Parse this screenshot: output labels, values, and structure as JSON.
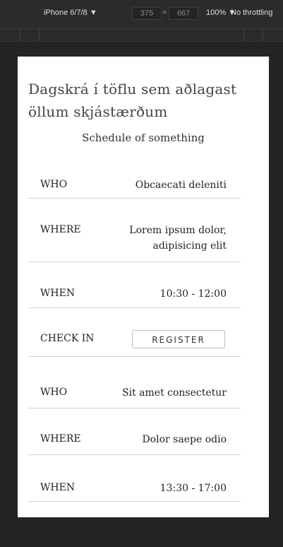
{
  "devtools": {
    "device": "iPhone 6/7/8 ▼",
    "width": "375",
    "times": "×",
    "height": "667",
    "zoom": "100% ▼",
    "throttling": "No throttling"
  },
  "page": {
    "title": "Dagskrá í töflu sem aðlagast öllum skjástærðum",
    "subtitle": "Schedule of something"
  },
  "schedule": [
    {
      "label": "WHO",
      "value": "Obcaecati deleniti"
    },
    {
      "label": "WHERE",
      "value": "Lorem ipsum dolor, adipisicing elit"
    },
    {
      "label": "WHEN",
      "value": "10:30 - 12:00"
    },
    {
      "label": "CHECK IN",
      "button": "REGISTER"
    },
    {
      "label": "WHO",
      "value": "Sit amet consectetur"
    },
    {
      "label": "WHERE",
      "value": "Dolor saepe odio"
    },
    {
      "label": "WHEN",
      "value": "13:30 - 17:00"
    }
  ]
}
